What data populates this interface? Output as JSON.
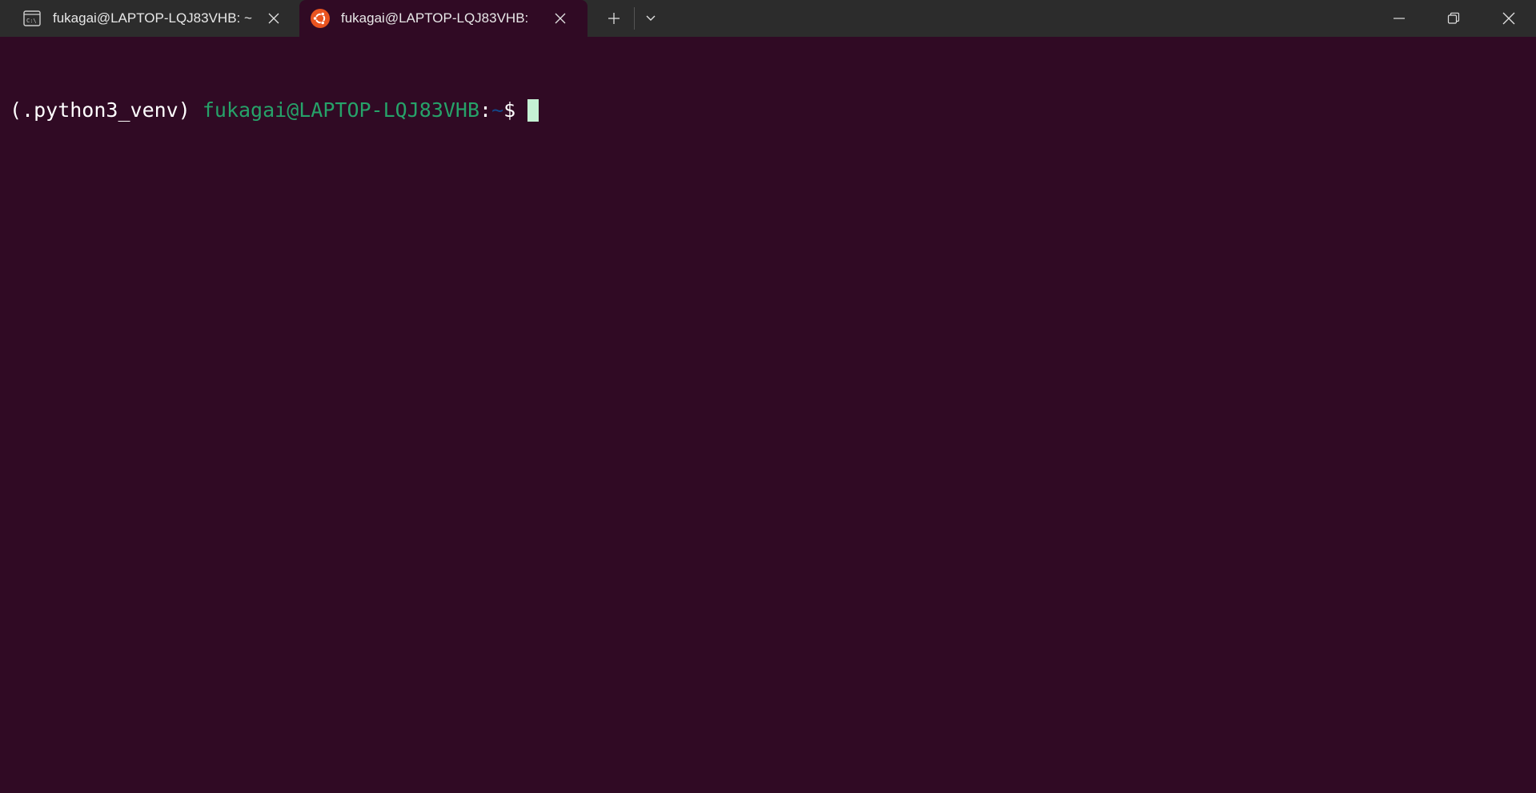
{
  "tabs": [
    {
      "title": "fukagai@LAPTOP-LQJ83VHB: ~",
      "icon": "cmd-prompt-icon",
      "active": false
    },
    {
      "title": "fukagai@LAPTOP-LQJ83VHB:",
      "icon": "ubuntu-icon",
      "active": true
    }
  ],
  "toolbar": {
    "new_tab_icon": "plus-icon",
    "dropdown_icon": "chevron-down-icon"
  },
  "window_controls": {
    "minimize_icon": "minimize-icon",
    "restore_icon": "restore-icon",
    "close_icon": "close-icon"
  },
  "terminal": {
    "venv": "(.python3_venv)",
    "user_host": "fukagai@LAPTOP-LQJ83VHB",
    "colon": ":",
    "cwd": "~",
    "prompt_symbol": "$"
  },
  "colors": {
    "background": "#300a24",
    "tabbar": "#2c2c2c",
    "user_host": "#26a269",
    "cwd": "#12488b",
    "cursor": "#c5f2d4",
    "ubuntu_orange": "#e95420"
  }
}
